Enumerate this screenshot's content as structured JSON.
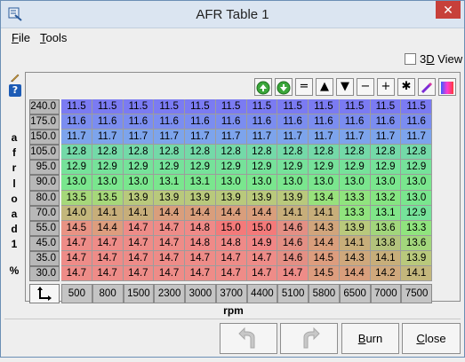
{
  "window": {
    "title": "AFR Table 1",
    "close_glyph": "✕"
  },
  "menu": {
    "file_mnemonic": "F",
    "file_rest": "ile",
    "tools_mnemonic": "T",
    "tools_rest": "ools"
  },
  "view3d": {
    "prefix": "3",
    "mnemonic": "D",
    "suffix": " View",
    "checked": false
  },
  "y_axis": {
    "title_chars": [
      "a",
      "f",
      "r",
      "l",
      "o",
      "a",
      "d",
      "1",
      "",
      "%"
    ],
    "values": [
      "240.0",
      "175.0",
      "150.0",
      "105.0",
      "95.0",
      "90.0",
      "80.0",
      "70.0",
      "55.0",
      "45.0",
      "35.0",
      "30.0"
    ]
  },
  "x_axis": {
    "title": "rpm",
    "values": [
      "500",
      "800",
      "1500",
      "2300",
      "3000",
      "3700",
      "4400",
      "5100",
      "5800",
      "6500",
      "7000",
      "7500"
    ]
  },
  "table": {
    "rows": [
      [
        "11.5",
        "11.5",
        "11.5",
        "11.5",
        "11.5",
        "11.5",
        "11.5",
        "11.5",
        "11.5",
        "11.5",
        "11.5",
        "11.5"
      ],
      [
        "11.6",
        "11.6",
        "11.6",
        "11.6",
        "11.6",
        "11.6",
        "11.6",
        "11.6",
        "11.6",
        "11.6",
        "11.6",
        "11.6"
      ],
      [
        "11.7",
        "11.7",
        "11.7",
        "11.7",
        "11.7",
        "11.7",
        "11.7",
        "11.7",
        "11.7",
        "11.7",
        "11.7",
        "11.7"
      ],
      [
        "12.8",
        "12.8",
        "12.8",
        "12.8",
        "12.8",
        "12.8",
        "12.8",
        "12.8",
        "12.8",
        "12.8",
        "12.8",
        "12.8"
      ],
      [
        "12.9",
        "12.9",
        "12.9",
        "12.9",
        "12.9",
        "12.9",
        "12.9",
        "12.9",
        "12.9",
        "12.9",
        "12.9",
        "12.9"
      ],
      [
        "13.0",
        "13.0",
        "13.0",
        "13.1",
        "13.1",
        "13.0",
        "13.0",
        "13.0",
        "13.0",
        "13.0",
        "13.0",
        "13.0"
      ],
      [
        "13.5",
        "13.5",
        "13.9",
        "13.9",
        "13.9",
        "13.9",
        "13.9",
        "13.9",
        "13.4",
        "13.3",
        "13.2",
        "13.0"
      ],
      [
        "14.0",
        "14.1",
        "14.1",
        "14.4",
        "14.4",
        "14.4",
        "14.4",
        "14.1",
        "14.1",
        "13.3",
        "13.1",
        "12.9"
      ],
      [
        "14.5",
        "14.4",
        "14.7",
        "14.7",
        "14.8",
        "15.0",
        "15.0",
        "14.6",
        "14.3",
        "13.9",
        "13.6",
        "13.3"
      ],
      [
        "14.7",
        "14.7",
        "14.7",
        "14.7",
        "14.8",
        "14.8",
        "14.9",
        "14.6",
        "14.4",
        "14.1",
        "13.8",
        "13.6"
      ],
      [
        "14.7",
        "14.7",
        "14.7",
        "14.7",
        "14.7",
        "14.7",
        "14.7",
        "14.6",
        "14.5",
        "14.3",
        "14.1",
        "13.9"
      ],
      [
        "14.7",
        "14.7",
        "14.7",
        "14.7",
        "14.7",
        "14.7",
        "14.7",
        "14.7",
        "14.5",
        "14.4",
        "14.2",
        "14.1"
      ]
    ],
    "colors": [
      [
        "#7b7bf2",
        "#7b7bf2",
        "#7b7bf2",
        "#7b7bf2",
        "#7b7bf2",
        "#7b7bf2",
        "#7b7bf2",
        "#7b7bf2",
        "#7b7bf2",
        "#7b7bf2",
        "#7b7bf2",
        "#7b7bf2"
      ],
      [
        "#7b8df0",
        "#7b8df0",
        "#7b8df0",
        "#7b8df0",
        "#7b8df0",
        "#7b8df0",
        "#7b8df0",
        "#7b8df0",
        "#7b8df0",
        "#7b8df0",
        "#7b8df0",
        "#7b8df0"
      ],
      [
        "#7da4ec",
        "#7da4ec",
        "#7da4ec",
        "#7da4ec",
        "#7da4ec",
        "#7da4ec",
        "#7da4ec",
        "#7da4ec",
        "#7da4ec",
        "#7da4ec",
        "#7da4ec",
        "#7da4ec"
      ],
      [
        "#74d9a8",
        "#74d9a8",
        "#74d9a8",
        "#74d9a8",
        "#74d9a8",
        "#74d9a8",
        "#74d9a8",
        "#74d9a8",
        "#74d9a8",
        "#74d9a8",
        "#74d9a8",
        "#74d9a8"
      ],
      [
        "#76e29a",
        "#76e29a",
        "#76e29a",
        "#76e29a",
        "#76e29a",
        "#76e29a",
        "#76e29a",
        "#76e29a",
        "#76e29a",
        "#76e29a",
        "#76e29a",
        "#76e29a"
      ],
      [
        "#7ae68e",
        "#7ae68e",
        "#7ae68e",
        "#7ae68e",
        "#7ae68e",
        "#7ae68e",
        "#7ae68e",
        "#7ae68e",
        "#7ae68e",
        "#7ae68e",
        "#7ae68e",
        "#7ae68e"
      ],
      [
        "#a6d87a",
        "#a6d87a",
        "#b9c97c",
        "#b9c97c",
        "#b9c97c",
        "#b9c97c",
        "#b9c97c",
        "#b9c97c",
        "#98e27c",
        "#90e47e",
        "#86e582",
        "#7ae68e"
      ],
      [
        "#c3b77c",
        "#c7ae7a",
        "#c7ae7a",
        "#d99e7c",
        "#d99e7c",
        "#d99e7c",
        "#d99e7c",
        "#c7ae7a",
        "#c7ae7a",
        "#90e47e",
        "#80e589",
        "#76e29a"
      ],
      [
        "#e89384",
        "#dd9d7e",
        "#ee8c88",
        "#ee8c88",
        "#ef8a88",
        "#f47a7a",
        "#f47a7a",
        "#e48f84",
        "#d1a57c",
        "#b9c97c",
        "#a2d67c",
        "#90e47e"
      ],
      [
        "#ee8c88",
        "#ee8c88",
        "#ee8c88",
        "#ee8c88",
        "#ef8a88",
        "#ef8a88",
        "#f08686",
        "#e48f84",
        "#d99e7c",
        "#c7ae7a",
        "#b2c27c",
        "#a2d67c"
      ],
      [
        "#ee8c88",
        "#ee8c88",
        "#ee8c88",
        "#ee8c88",
        "#ee8c88",
        "#ee8c88",
        "#ee8c88",
        "#e48f84",
        "#dd9d7e",
        "#cfa87c",
        "#c7ae7a",
        "#b9c97c"
      ],
      [
        "#ee8c88",
        "#ee8c88",
        "#ee8c88",
        "#ee8c88",
        "#ee8c88",
        "#ee8c88",
        "#ee8c88",
        "#ee8c88",
        "#dd9d7e",
        "#d99e7c",
        "#cfa87c",
        "#c3b77c"
      ]
    ]
  },
  "toolbar": {
    "buttons": [
      {
        "icon": "increment-green-icon",
        "glyph": ""
      },
      {
        "icon": "decrement-green-icon",
        "glyph": ""
      },
      {
        "icon": "set-equal-icon",
        "glyph": "="
      },
      {
        "icon": "increase-icon",
        "glyph": "▲"
      },
      {
        "icon": "decrease-icon",
        "glyph": "▼"
      },
      {
        "icon": "subtract-icon",
        "glyph": "−"
      },
      {
        "icon": "add-icon",
        "glyph": "+"
      },
      {
        "icon": "multiply-icon",
        "glyph": "✱"
      },
      {
        "icon": "interpolate-icon",
        "glyph": ""
      },
      {
        "icon": "color-gradient-icon",
        "glyph": ""
      }
    ]
  },
  "buttons": {
    "burn_mnemonic": "B",
    "burn_rest": "urn",
    "close_mnemonic": "C",
    "close_rest": "lose"
  }
}
